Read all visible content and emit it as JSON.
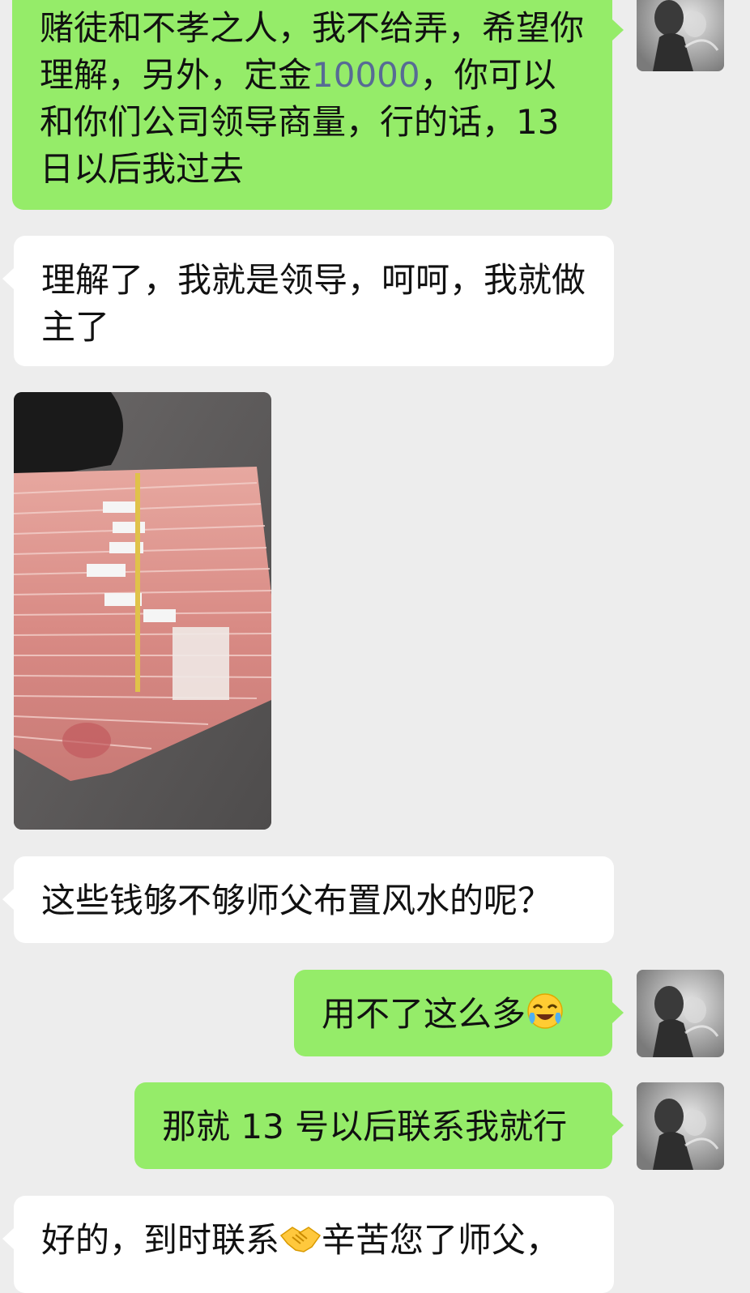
{
  "messages": [
    {
      "side": "sent",
      "text_before": "赌徒和不孝之人，我不给弄，希望你理解，另外，定金",
      "amount": "10000",
      "text_after": "，你可以和你们公司领导商量，行的话，13 日以后我过去"
    },
    {
      "side": "received",
      "text": "理解了，我就是领导，呵呵，我就做主了"
    },
    {
      "side": "received",
      "type": "image",
      "image_desc": "stack-of-100-yuan-banknotes"
    },
    {
      "side": "received",
      "text": "这些钱够不够师父布置风水的呢？"
    },
    {
      "side": "sent",
      "text": "用不了这么多",
      "emoji": "crying-laughing-face"
    },
    {
      "side": "sent",
      "text": "那就 13 号以后联系我就行"
    },
    {
      "side": "received",
      "text_before": "好的，到时联系",
      "emoji": "handshake",
      "text_after": "辛苦您了师父，"
    }
  ],
  "colors": {
    "background": "#ededed",
    "sent_bubble": "#95ec69",
    "received_bubble": "#ffffff",
    "highlight_number": "#576b95"
  }
}
